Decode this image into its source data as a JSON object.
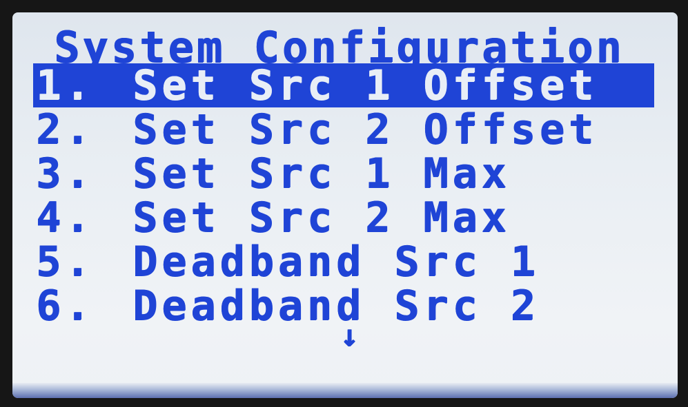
{
  "screen": {
    "title": "System Configuration",
    "menu_items": [
      {
        "number": "1.",
        "label": "Set Src 1 Offset",
        "selected": true
      },
      {
        "number": "2.",
        "label": "Set Src 2 Offset",
        "selected": false
      },
      {
        "number": "3.",
        "label": "Set Src 1 Max",
        "selected": false
      },
      {
        "number": "4.",
        "label": "Set Src 2 Max",
        "selected": false
      },
      {
        "number": "5.",
        "label": "Deadband Src 1",
        "selected": false
      },
      {
        "number": "6.",
        "label": "Deadband Src 2",
        "selected": false
      }
    ],
    "scroll_indicator": "↓"
  },
  "colors": {
    "text": "#1f44d6",
    "background": "#e9eef3",
    "highlight": "#1f44d6"
  },
  "icons": {
    "scroll_indicator": "arrow-down-icon"
  }
}
